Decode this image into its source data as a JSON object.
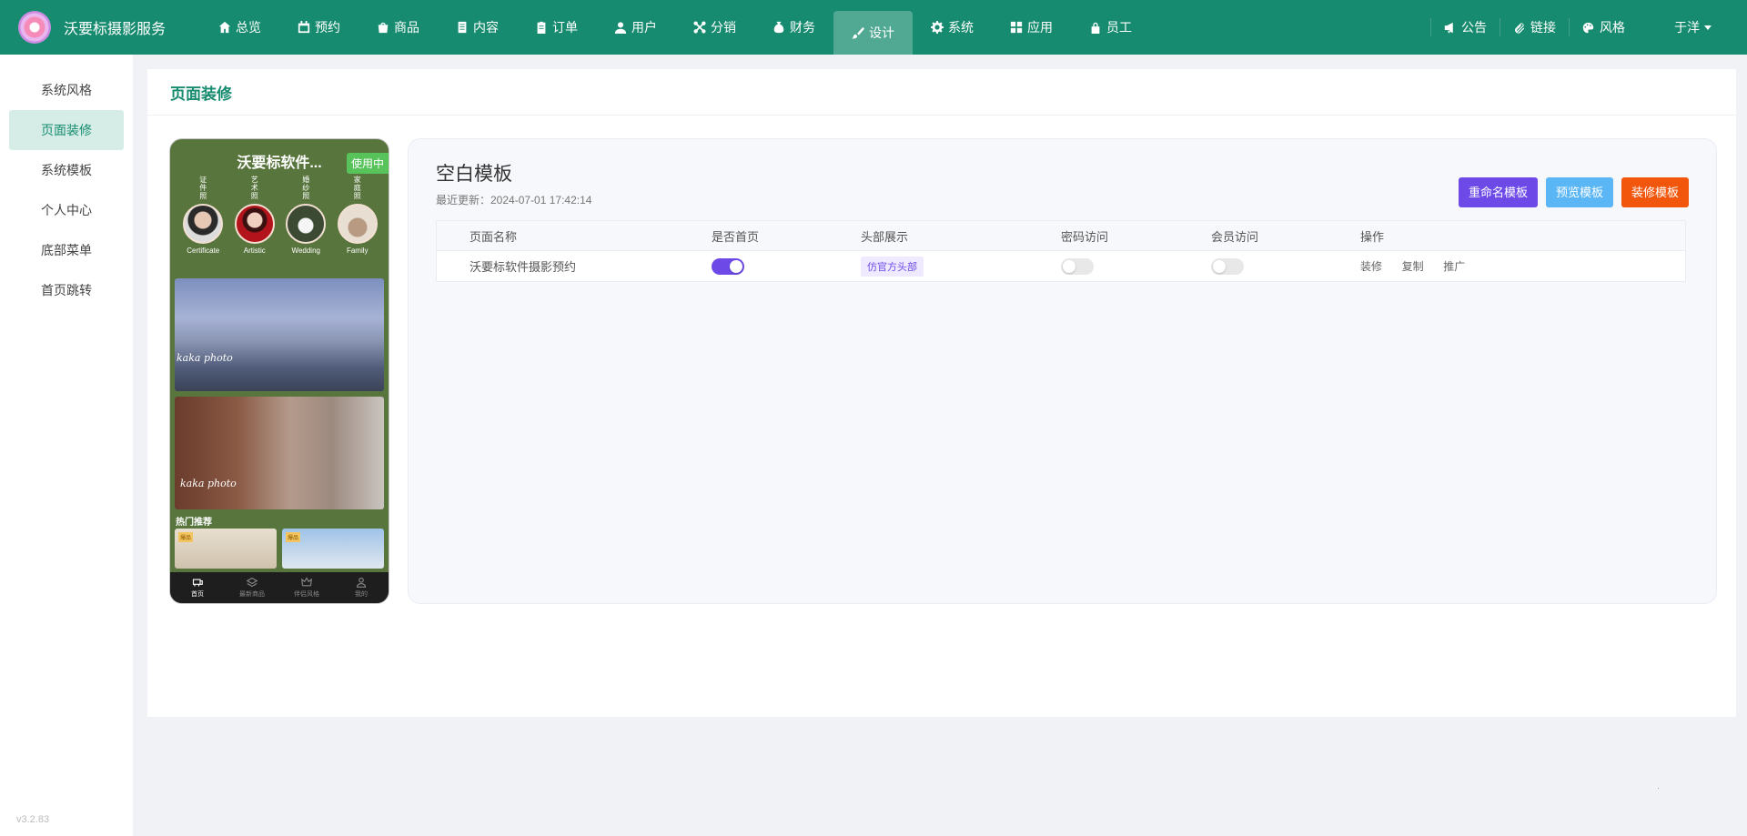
{
  "app": {
    "name": "沃要标摄影服务"
  },
  "nav": [
    {
      "label": "总览",
      "icon": "home-icon"
    },
    {
      "label": "预约",
      "icon": "calendar-icon"
    },
    {
      "label": "商品",
      "icon": "bag-icon"
    },
    {
      "label": "内容",
      "icon": "document-icon"
    },
    {
      "label": "订单",
      "icon": "clipboard-icon"
    },
    {
      "label": "用户",
      "icon": "user-icon"
    },
    {
      "label": "分销",
      "icon": "network-icon"
    },
    {
      "label": "财务",
      "icon": "money-bag-icon"
    },
    {
      "label": "设计",
      "icon": "brush-icon",
      "active": true
    },
    {
      "label": "系统",
      "icon": "gear-icon"
    },
    {
      "label": "应用",
      "icon": "grid-icon"
    },
    {
      "label": "员工",
      "icon": "lock-icon"
    }
  ],
  "topRight": {
    "notice": "公告",
    "link": "链接",
    "style": "风格",
    "user": "于洋"
  },
  "sidebar": {
    "items": [
      {
        "label": "系统风格"
      },
      {
        "label": "页面装修",
        "active": true
      },
      {
        "label": "系统模板"
      },
      {
        "label": "个人中心"
      },
      {
        "label": "底部菜单"
      },
      {
        "label": "首页跳转"
      }
    ],
    "version": "v3.2.83"
  },
  "page": {
    "title": "页面装修"
  },
  "phone": {
    "title": "沃要标软件...",
    "badge": "使用中",
    "categories": [
      {
        "vertical": "证件照",
        "label": "Certificate"
      },
      {
        "vertical": "艺术照",
        "label": "Artistic"
      },
      {
        "vertical": "婚纱照",
        "label": "Wedding"
      },
      {
        "vertical": "家庭照",
        "label": "Family"
      }
    ],
    "photoText1": "kaka photo",
    "photoText2": "kaka photo",
    "hotTitle": "热门推荐",
    "hotTag": "爆品",
    "tabs": [
      "首页",
      "最新商品",
      "伴侣风格",
      "我的"
    ]
  },
  "template": {
    "name": "空白模板",
    "updated": "最近更新：2024-07-01 17:42:14",
    "buttons": {
      "rename": "重命名模板",
      "preview": "预览模板",
      "decorate": "装修模板"
    },
    "columns": [
      "页面名称",
      "是否首页",
      "头部展示",
      "密码访问",
      "会员访问",
      "操作"
    ],
    "rows": [
      {
        "name": "沃要标软件摄影预约",
        "isHome": true,
        "header": "仿官方头部",
        "password": false,
        "member": false,
        "actions": [
          "装修",
          "复制",
          "推广"
        ]
      }
    ]
  },
  "colors": {
    "primary": "#178b6f",
    "accent": "#6d4ae8",
    "preview": "#5ab6f4",
    "decorate": "#f2560d"
  }
}
